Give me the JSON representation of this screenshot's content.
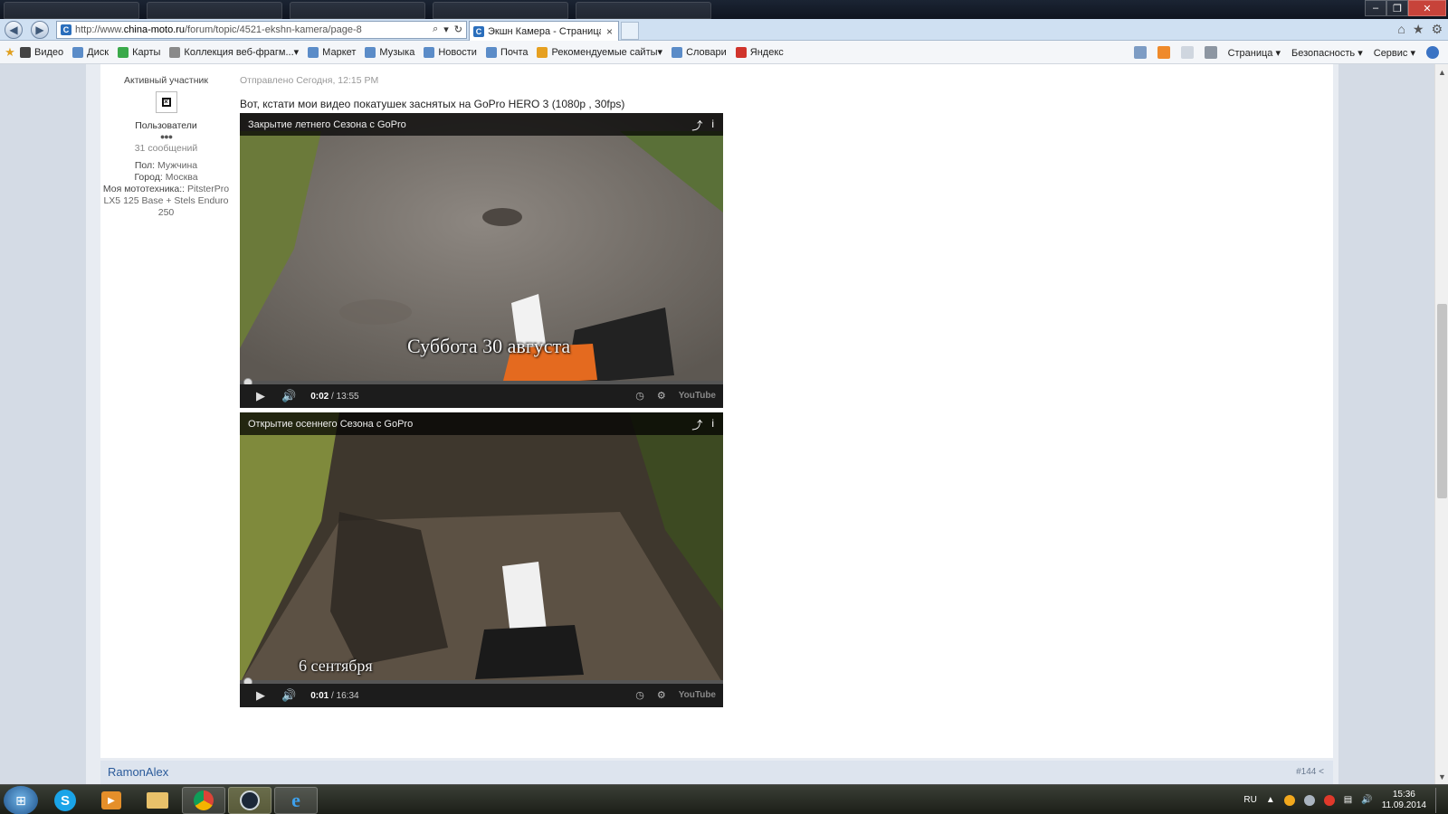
{
  "browser": {
    "url_prefix": "http://www.",
    "url_domain": "china-moto.ru",
    "url_path": "/forum/topic/4521-ekshn-kamera/page-8",
    "active_tab_title": "Экшн Камера - Страница ...",
    "tab_close": "×"
  },
  "window_controls": {
    "minimize": "–",
    "restore": "❐",
    "close": "✕"
  },
  "favorites": {
    "items": [
      {
        "label": "Видео",
        "color": "#444444"
      },
      {
        "label": "Диск",
        "color": "#5b8cc8"
      },
      {
        "label": "Карты",
        "color": "#3aa94a"
      },
      {
        "label": "Коллекция веб-фрагм...",
        "color": "#8a8a8a"
      },
      {
        "label": "Маркет",
        "color": "#5b8cc8"
      },
      {
        "label": "Музыка",
        "color": "#5b8cc8"
      },
      {
        "label": "Новости",
        "color": "#5b8cc8"
      },
      {
        "label": "Почта",
        "color": "#5b8cc8"
      },
      {
        "label": "Рекомендуемые сайты",
        "color": "#e6a020"
      },
      {
        "label": "Словари",
        "color": "#5b8cc8"
      },
      {
        "label": "Яндекс",
        "color": "#d0342c"
      }
    ],
    "menus": [
      "Страница",
      "Безопасность",
      "Сервис"
    ]
  },
  "post": {
    "author_rank": "Активный участник",
    "author_group": "Пользователи",
    "pips": "●●●",
    "post_count": "31 сообщений",
    "profile": [
      {
        "label": "Пол:",
        "value": "Мужчина"
      },
      {
        "label": "Город:",
        "value": "Москва"
      },
      {
        "label": "Моя мототехника::",
        "value": "PitsterPro LX5 125 Base + Stels Enduro 250"
      }
    ],
    "date": "Отправлено Сегодня, 12:15 PM",
    "text": "Вот, кстати мои видео покатушек заснятых на GoPro HERO 3 (1080p , 30fps)"
  },
  "videos": [
    {
      "title": "Закрытие летнего Сезона с GoPro",
      "caption": "Суббота 30 августа",
      "time_current": "0:02",
      "time_total": "/ 13:55",
      "progress": 0.002
    },
    {
      "title": "Открытие осеннего Сезона с GoPro",
      "caption": "6 сентября",
      "time_current": "0:01",
      "time_total": "/ 16:34",
      "progress": 0.001
    }
  ],
  "video_controls": {
    "play": "▶",
    "volume": "🔊",
    "share": "⤴",
    "info": "i",
    "settings": "⚙",
    "youtube": "YouTube"
  },
  "next_post": {
    "author": "RamonAlex",
    "number": "#144"
  },
  "taskbar": {
    "language": "RU",
    "time": "15:36",
    "date": "11.09.2014"
  }
}
